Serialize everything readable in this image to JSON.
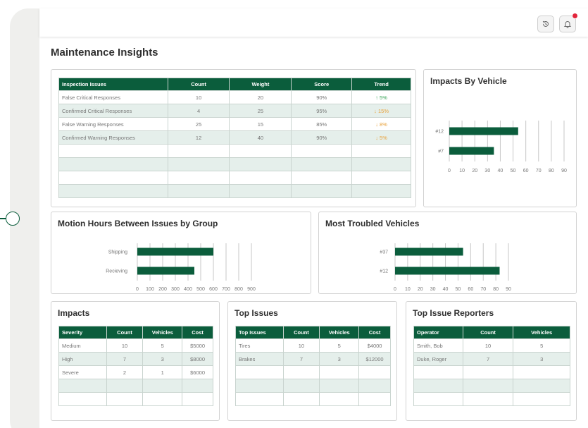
{
  "page": {
    "title": "Maintenance Insights"
  },
  "topbar": {
    "history_icon": "history-icon",
    "bell_icon": "bell-icon"
  },
  "inspection": {
    "headers": [
      "Inspection Issues",
      "Count",
      "Weight",
      "Score",
      "Trend"
    ],
    "rows": [
      {
        "issue": "False Critical Responses",
        "count": "10",
        "weight": "20",
        "score": "90%",
        "trend": "↑ 5%",
        "dir": "up"
      },
      {
        "issue": "Confirmed Critical Responses",
        "count": "4",
        "weight": "25",
        "score": "95%",
        "trend": "↓ 15%",
        "dir": "down"
      },
      {
        "issue": "False Warning Responses",
        "count": "25",
        "weight": "15",
        "score": "85%",
        "trend": "↓ 8%",
        "dir": "down"
      },
      {
        "issue": "Confirmed Warning Responses",
        "count": "12",
        "weight": "40",
        "score": "90%",
        "trend": "↓ 5%",
        "dir": "down"
      }
    ],
    "empty_rows": 4
  },
  "charts_titles": {
    "impacts_by_vehicle": "Impacts By Vehicle",
    "motion_hours": "Motion Hours Between Issues by Group",
    "most_troubled": "Most Troubled Vehicles"
  },
  "chart_data": [
    {
      "type": "bar",
      "title": "Impacts By Vehicle",
      "orientation": "horizontal",
      "categories": [
        "#12",
        "#7"
      ],
      "values": [
        54,
        35
      ],
      "xlim": [
        0,
        90
      ],
      "ticks": [
        0,
        10,
        20,
        30,
        40,
        50,
        60,
        70,
        80,
        90
      ],
      "color": "#0b5d3c"
    },
    {
      "type": "bar",
      "title": "Motion Hours Between Issues by Group",
      "orientation": "horizontal",
      "categories": [
        "Shipping",
        "Recieving"
      ],
      "values": [
        600,
        450
      ],
      "xlim": [
        0,
        900
      ],
      "ticks": [
        0,
        100,
        200,
        300,
        400,
        500,
        600,
        700,
        800,
        900
      ],
      "color": "#0b5d3c"
    },
    {
      "type": "bar",
      "title": "Most Troubled Vehicles",
      "orientation": "horizontal",
      "categories": [
        "#37",
        "#12"
      ],
      "values": [
        54,
        83
      ],
      "xlim": [
        0,
        90
      ],
      "ticks": [
        0,
        10,
        20,
        30,
        40,
        50,
        60,
        70,
        80,
        90
      ],
      "color": "#0b5d3c"
    }
  ],
  "impacts": {
    "title": "Impacts",
    "headers": [
      "Severity",
      "Count",
      "Vehicles",
      "Cost"
    ],
    "rows": [
      [
        "Medium",
        "10",
        "5",
        "$5000"
      ],
      [
        "High",
        "7",
        "3",
        "$8000"
      ],
      [
        "Severe",
        "2",
        "1",
        "$6000"
      ]
    ],
    "empty_rows": 2
  },
  "top_issues": {
    "title": "Top Issues",
    "headers": [
      "Top Issues",
      "Count",
      "Vehicles",
      "Cost"
    ],
    "rows": [
      [
        "Tires",
        "10",
        "5",
        "$4000"
      ],
      [
        "Brakes",
        "7",
        "3",
        "$12000"
      ]
    ],
    "empty_rows": 3
  },
  "top_reporters": {
    "title": "Top Issue Reporters",
    "headers": [
      "Operator",
      "Count",
      "Vehicles"
    ],
    "rows": [
      [
        "Smith, Bob",
        "10",
        "5"
      ],
      [
        "Duke, Roger",
        "7",
        "3"
      ]
    ],
    "empty_rows": 3
  }
}
